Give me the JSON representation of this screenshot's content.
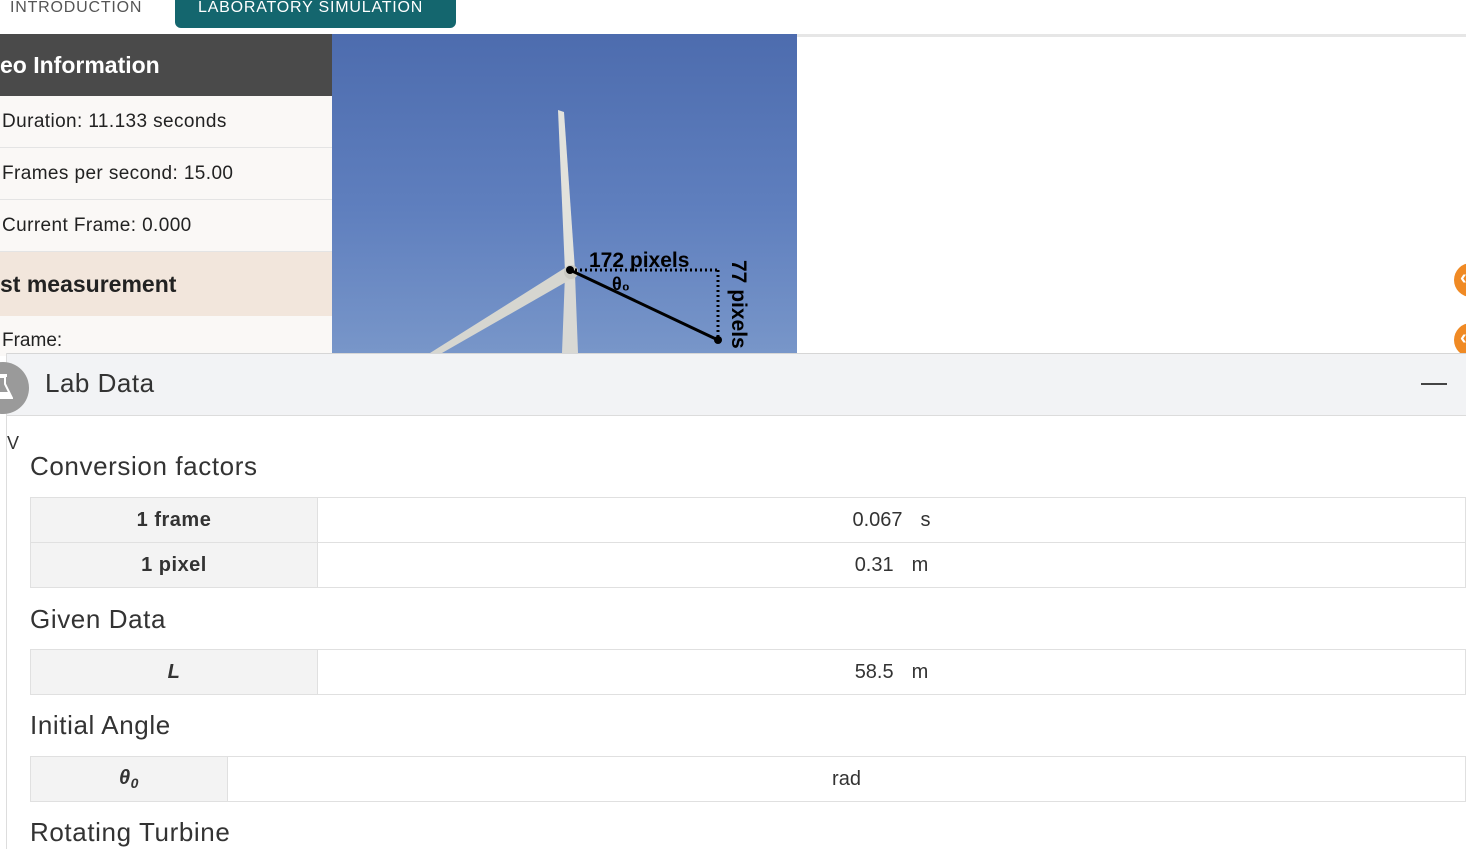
{
  "tabs": [
    {
      "label": "INTRODUCTION",
      "active": false
    },
    {
      "label": "LABORATORY SIMULATION",
      "active": true
    }
  ],
  "video_info": {
    "title": "eo Information",
    "duration": "Duration: 11.133 seconds",
    "fps": "Frames per second: 15.00",
    "current_frame": "Current Frame: 0.000",
    "measurement_title": "st measurement",
    "frame_label": "Frame:"
  },
  "video_overlay": {
    "horizontal_label": "172 pixels",
    "angle_label": "θ₀",
    "vertical_label": "77 pixels"
  },
  "lab_panel": {
    "title": "Lab Data",
    "icon": "flask-icon",
    "stray_char": "V"
  },
  "conversion_factors": {
    "title": "Conversion factors",
    "rows": [
      {
        "key": "1 frame",
        "value": "0.067",
        "unit": "s"
      },
      {
        "key": "1 pixel",
        "value": "0.31",
        "unit": "m"
      }
    ]
  },
  "given_data": {
    "title": "Given Data",
    "rows": [
      {
        "key": "L",
        "value": "58.5",
        "unit": "m"
      }
    ]
  },
  "initial_angle": {
    "title": "Initial Angle",
    "key_symbol": "θ",
    "key_sub": "0",
    "value": "",
    "unit": "rad"
  },
  "rotating_turbine": {
    "title": "Rotating Turbine"
  },
  "colors": {
    "tab_active": "#14666e",
    "info_header": "#4a4a4a",
    "measurement_header": "#f2e6dc",
    "side_button": "#f08a24",
    "sky": "#5f7fbe"
  }
}
